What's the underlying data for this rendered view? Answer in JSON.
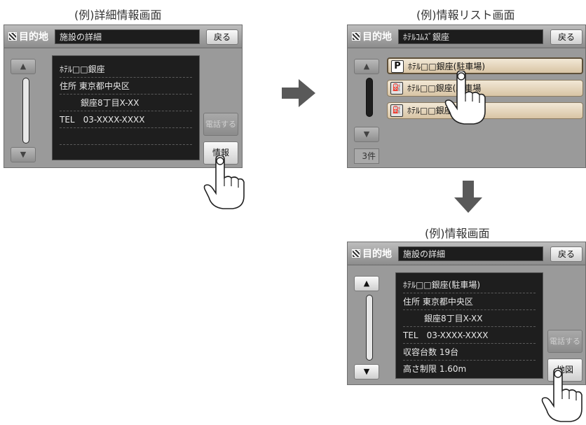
{
  "captions": {
    "detail": "(例)詳細情報画面",
    "list": "(例)情報リスト画面",
    "info": "(例)情報画面"
  },
  "screen_detail": {
    "destination_label": "目的地",
    "title": "施設の詳細",
    "back_button": "戻る",
    "rows": [
      "ﾎﾃﾙ□□銀座",
      "住所 東京都中央区",
      "銀座8丁目X-XX",
      "TEL　03-XXXX-XXXX"
    ],
    "call_button": "電話する",
    "info_button": "情報"
  },
  "screen_list": {
    "destination_label": "目的地",
    "title": "ﾎﾃﾙｺﾑｽﾞ銀座",
    "back_button": "戻る",
    "items": [
      {
        "icon": "P",
        "label": "ﾎﾃﾙ□□銀座(駐車場)"
      },
      {
        "icon": "⛽",
        "label": "ﾎﾃﾙ□□銀座(駐車場"
      },
      {
        "icon": "⛽",
        "label": "ﾎﾃﾙ□□銀座"
      }
    ],
    "count": "3件"
  },
  "screen_info": {
    "destination_label": "目的地",
    "title": "施設の詳細",
    "back_button": "戻る",
    "rows": [
      "ﾎﾃﾙ□□銀座(駐車場)",
      "住所 東京都中央区",
      "銀座8丁目X-XX",
      "TEL　03-XXXX-XXXX",
      "収容台数 19台",
      "高さ制限 1.60m"
    ],
    "call_button": "電話する",
    "map_button": "地図"
  },
  "colors": {
    "arrow": "#595959",
    "panel": "#9a9a9a",
    "info_bg": "#1e1e1e",
    "list_item": "#e6d6ba"
  },
  "scroll_icons": {
    "up": "▲",
    "down": "▼"
  }
}
